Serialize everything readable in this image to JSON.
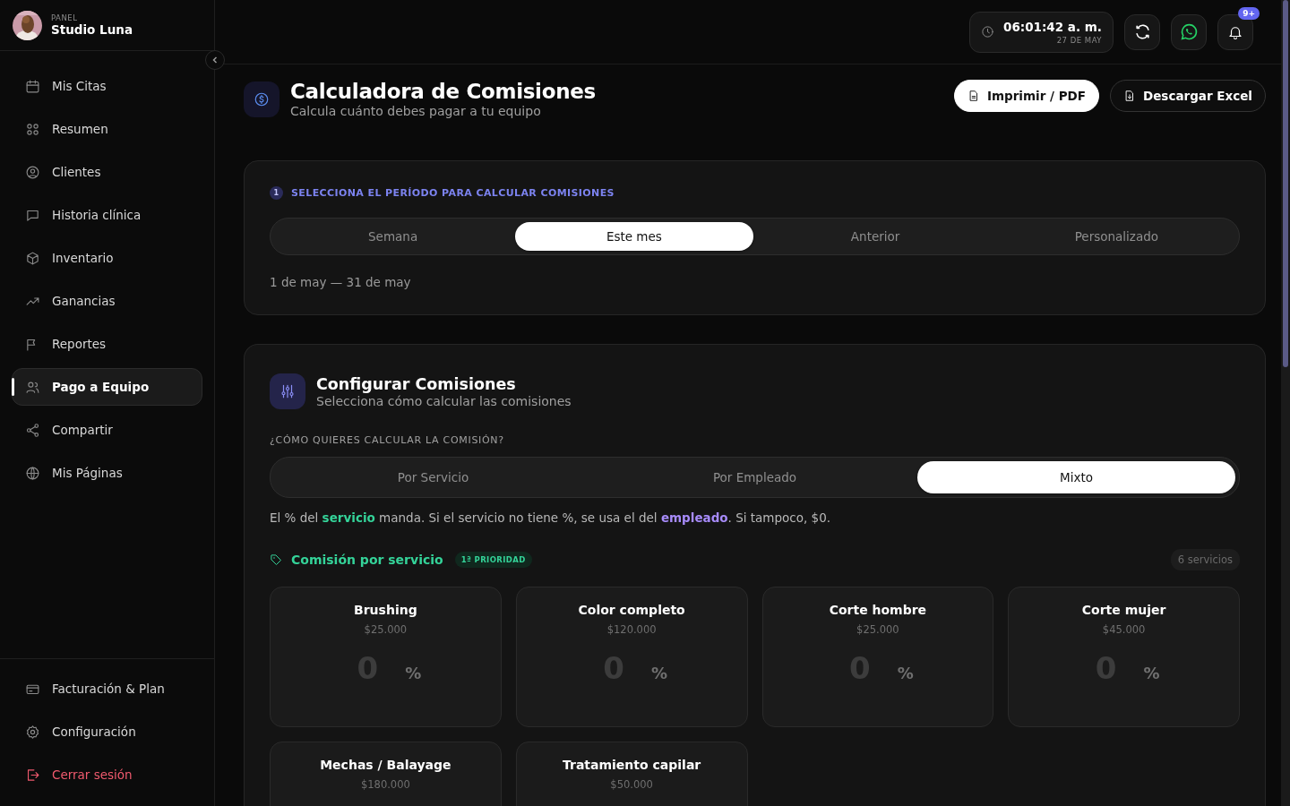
{
  "sidebar": {
    "panel_label": "PANEL",
    "studio_name": "Studio Luna",
    "nav_items": [
      {
        "label": "Mis Citas",
        "selected": false
      },
      {
        "label": "Resumen",
        "selected": false
      },
      {
        "label": "Clientes",
        "selected": false
      },
      {
        "label": "Historia clínica",
        "selected": false
      },
      {
        "label": "Inventario",
        "selected": false
      },
      {
        "label": "Ganancias",
        "selected": false
      },
      {
        "label": "Reportes",
        "selected": false
      },
      {
        "label": "Pago a Equipo",
        "selected": true
      },
      {
        "label": "Compartir",
        "selected": false
      },
      {
        "label": "Mis Páginas",
        "selected": false
      }
    ],
    "footer_items": [
      {
        "label": "Facturación & Plan",
        "kind": "normal"
      },
      {
        "label": "Configuración",
        "kind": "normal"
      },
      {
        "label": "Cerrar sesión",
        "kind": "danger"
      }
    ]
  },
  "topbar": {
    "time": "06:01:42 a. m.",
    "date": "27 DE MAY",
    "notification_badge": "9+"
  },
  "header": {
    "title": "Calculadora de Comisiones",
    "subtitle": "Calcula cuánto debes pagar a tu equipo",
    "buttons": [
      {
        "label": "Imprimir / PDF",
        "kind": "primary"
      },
      {
        "label": "Descargar Excel",
        "kind": "outline"
      }
    ]
  },
  "period": {
    "step": "1",
    "heading": "SELECCIONA EL PERÍODO PARA CALCULAR COMISIONES",
    "options": [
      {
        "label": "Semana",
        "selected": false
      },
      {
        "label": "Este mes",
        "selected": true
      },
      {
        "label": "Anterior",
        "selected": false
      },
      {
        "label": "Personalizado",
        "selected": false
      }
    ],
    "range": "1 de may — 31 de may"
  },
  "config": {
    "title": "Configurar Comisiones",
    "subtitle": "Selecciona cómo calcular las comisiones",
    "question": "¿CÓMO QUIERES CALCULAR LA COMISIÓN?",
    "modes": [
      {
        "label": "Por Servicio",
        "selected": false
      },
      {
        "label": "Por Empleado",
        "selected": false
      },
      {
        "label": "Mixto",
        "selected": true
      }
    ],
    "note": "El % del **servicio** manda. Si el servicio no tiene %, se usa el del **empleado**. Si tampoco, $0.",
    "section_title": "Comisión por servicio",
    "priority_badge": "1ª PRIORIDAD",
    "count": "6 servicios",
    "services": [
      {
        "name": "Brushing",
        "price": "$25.000",
        "placeholder": "0",
        "unit": "%"
      },
      {
        "name": "Color completo",
        "price": "$120.000",
        "placeholder": "0",
        "unit": "%"
      },
      {
        "name": "Corte hombre",
        "price": "$25.000",
        "placeholder": "0",
        "unit": "%"
      },
      {
        "name": "Corte mujer",
        "price": "$45.000",
        "placeholder": "0",
        "unit": "%"
      },
      {
        "name": "Mechas / Balayage",
        "price": "$180.000"
      },
      {
        "name": "Tratamiento capilar",
        "price": "$50.000"
      }
    ]
  }
}
